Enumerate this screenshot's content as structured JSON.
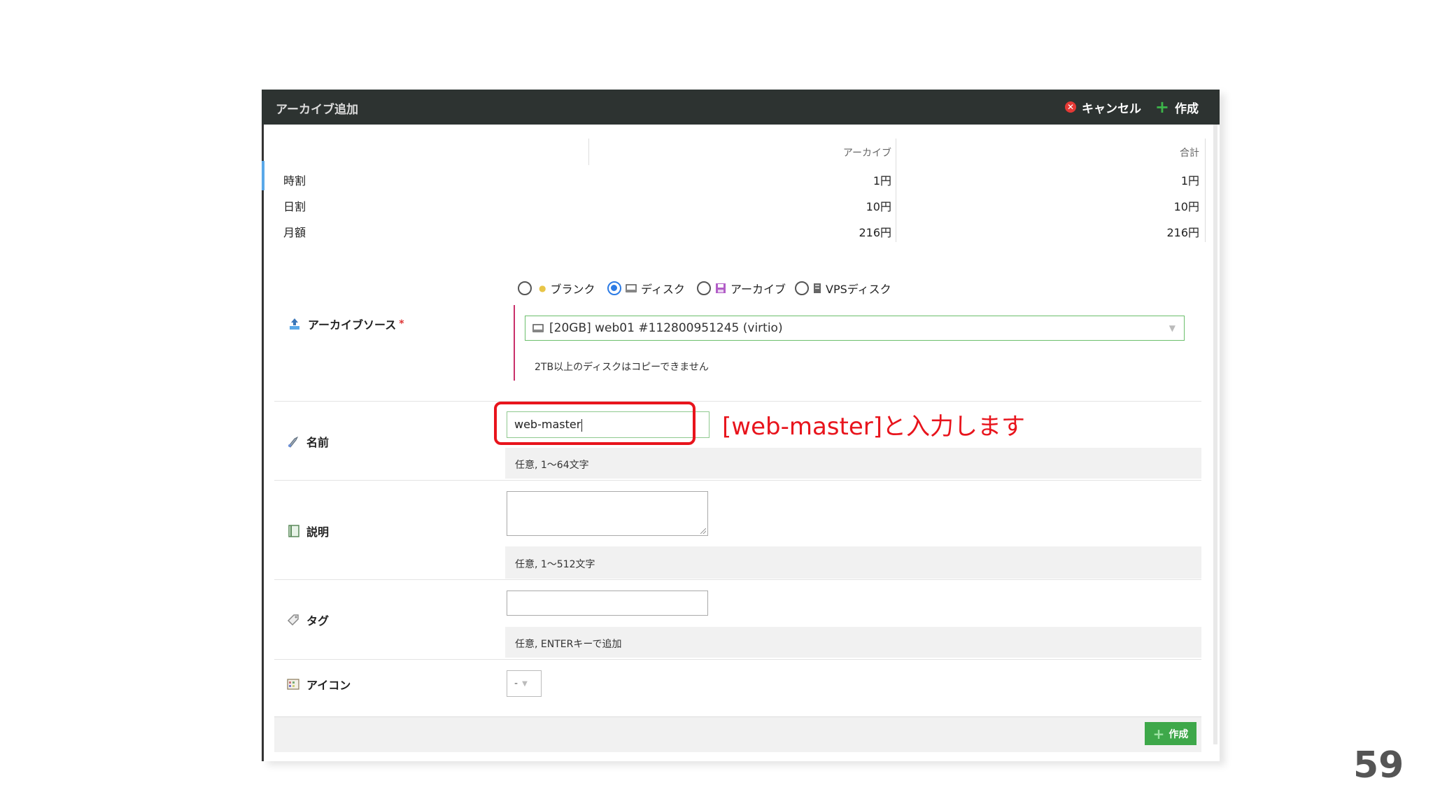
{
  "dialog": {
    "title": "アーカイブ追加",
    "cancel_label": "キャンセル",
    "create_label": "作成"
  },
  "price_table": {
    "headers": [
      "アーカイブ",
      "合計"
    ],
    "rows": [
      {
        "label": "時割",
        "archive": "1円",
        "total": "1円"
      },
      {
        "label": "日割",
        "archive": "10円",
        "total": "10円"
      },
      {
        "label": "月額",
        "archive": "216円",
        "total": "216円"
      }
    ]
  },
  "form": {
    "source": {
      "label": "アーカイブソース",
      "required_mark": "*",
      "options": [
        "ブランク",
        "ディスク",
        "アーカイブ",
        "VPSディスク"
      ],
      "selected_option": "ディスク",
      "selected_value": "[20GB] web01 #112800951245 (virtio)",
      "note": "2TB以上のディスクはコピーできません"
    },
    "name": {
      "label": "名前",
      "value": "web-master",
      "hint": "任意, 1〜64文字"
    },
    "description": {
      "label": "説明",
      "value": "",
      "hint": "任意, 1〜512文字"
    },
    "tag": {
      "label": "タグ",
      "value": "",
      "hint": "任意, ENTERキーで追加"
    },
    "icon": {
      "label": "アイコン",
      "value": "-"
    }
  },
  "footer": {
    "create_label": "作成"
  },
  "annotation": "[web-master]と入力します",
  "page_number": "59",
  "colors": {
    "titlebar": "#2d3331",
    "accent_green": "#3ea84a",
    "highlight_red": "#e8141c",
    "radio_selected": "#2c7be5"
  },
  "icons": [
    "cancel-x-icon",
    "plus-icon",
    "upload-icon",
    "radio-dot-icon",
    "disk-icon",
    "archive-floppy-icon",
    "vps-disk-icon",
    "name-tag-icon",
    "notebook-icon",
    "tag-icon",
    "icon-grid-icon",
    "chevron-down-icon"
  ]
}
